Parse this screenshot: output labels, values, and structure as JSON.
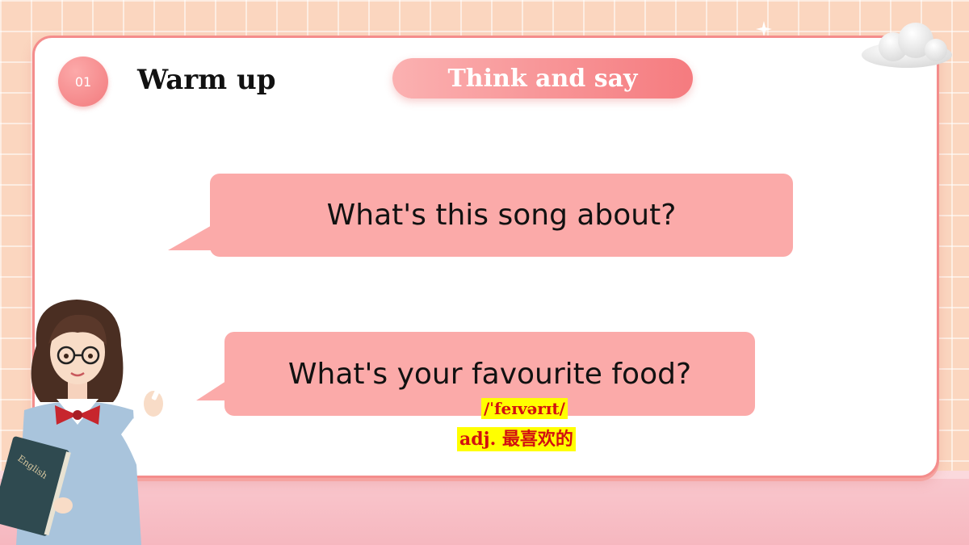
{
  "header": {
    "badge_number": "01",
    "section_title": "Warm up",
    "activity_label": "Think and say"
  },
  "questions": [
    {
      "text": "What's this song about?"
    },
    {
      "text": "What's your favourite food?"
    }
  ],
  "vocab_note": {
    "phonetic": "/ˈfeɪvərɪt/",
    "meaning": "adj. 最喜欢的"
  },
  "book_label": "English",
  "colors": {
    "accent": "#f57b7f",
    "bubble": "#fbaaa9",
    "highlight": "#ffff00",
    "note_text": "#d21010",
    "background": "#fbd6bf"
  },
  "icons": [
    "cloud-icon",
    "sparkle-icon"
  ]
}
